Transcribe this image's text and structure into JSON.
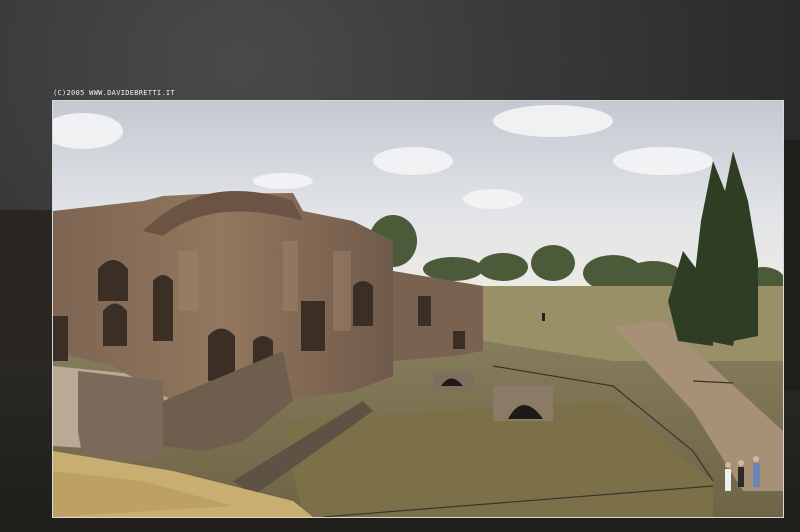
{
  "photo_caption": "(C)2005 WWW.DAVIDEBRETTI.IT",
  "colors": {
    "backdrop": "#2e2e2e",
    "sky": "#cdd2d9",
    "ruin_brick": "#8a6e56",
    "grass": "#7a7250",
    "trees": "#3d4a2e"
  }
}
